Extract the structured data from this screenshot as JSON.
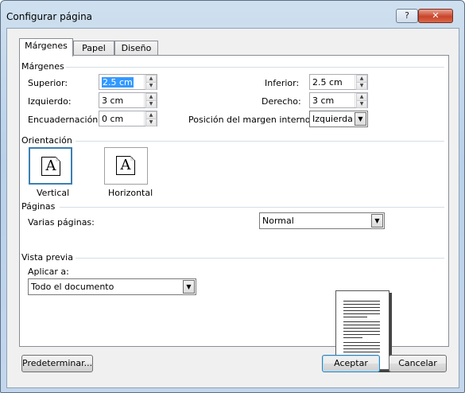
{
  "window": {
    "title": "Configurar página",
    "help_label": "?",
    "close_label": "✕"
  },
  "tabs": [
    {
      "label": "Márgenes",
      "active": true
    },
    {
      "label": "Papel",
      "active": false
    },
    {
      "label": "Diseño",
      "active": false
    }
  ],
  "margins": {
    "section_label": "Márgenes",
    "superior": {
      "label": "Superior:",
      "value": "2.5 cm"
    },
    "izquierdo": {
      "label": "Izquierdo:",
      "value": "3 cm"
    },
    "encuadernacion": {
      "label": "Encuadernación:",
      "value": "0 cm"
    },
    "inferior": {
      "label": "Inferior:",
      "value": "2.5 cm"
    },
    "derecho": {
      "label": "Derecho:",
      "value": "3 cm"
    },
    "posicion": {
      "label": "Posición del margen interno:",
      "value": "Izquierda"
    }
  },
  "orientation": {
    "section_label": "Orientación",
    "vertical": {
      "label": "Vertical",
      "icon": "A"
    },
    "horizontal": {
      "label": "Horizontal",
      "icon": "A"
    }
  },
  "pages": {
    "section_label": "Páginas",
    "varias_label": "Varias páginas:",
    "varias_value": "Normal"
  },
  "preview": {
    "section_label": "Vista previa",
    "aplicar_label": "Aplicar a:",
    "aplicar_value": "Todo el documento"
  },
  "buttons": {
    "predeterminar": "Predeterminar...",
    "aceptar": "Aceptar",
    "cancelar": "Cancelar"
  }
}
